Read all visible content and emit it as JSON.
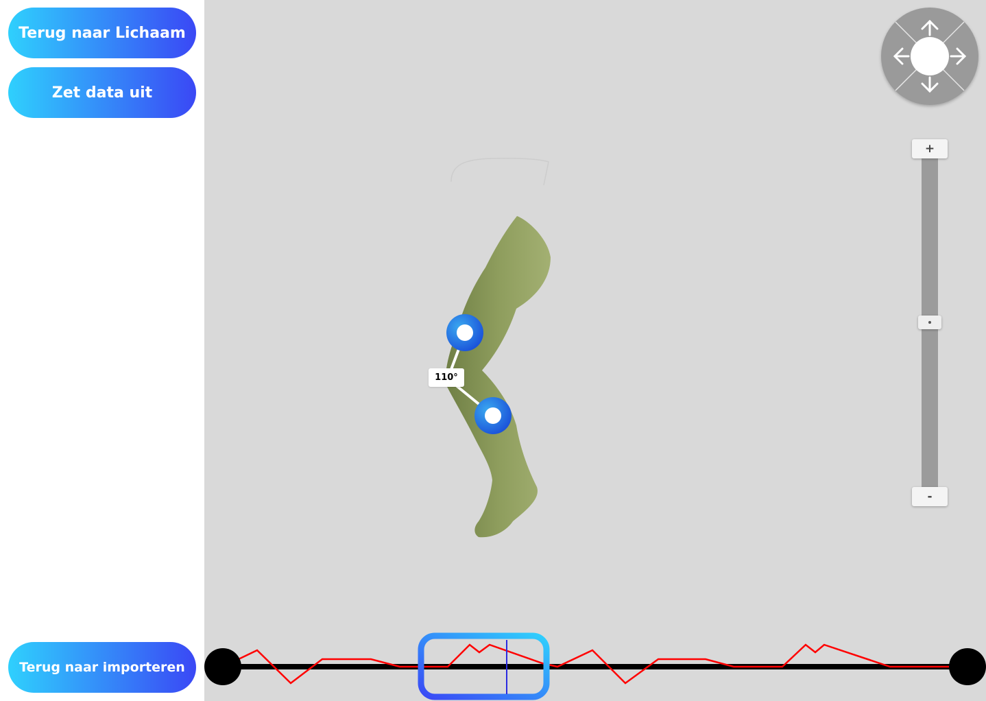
{
  "sidebar": {
    "back_to_body_label": "Terug naar Lichaam",
    "toggle_data_label": "Zet data uit",
    "back_to_import_label": "Terug naar importeren"
  },
  "viewer": {
    "angle_label": "110°",
    "joint_color": "#1e6fe0",
    "leg_color": "#8a9a5b"
  },
  "zoom": {
    "plus_label": "+",
    "minus_label": "-",
    "level": 0.5
  },
  "navigation": {
    "icon": "pan-arrows-icon"
  },
  "timeline": {
    "track_color": "#000000",
    "curve_color": "#ff0000",
    "window_gradient": [
      "#2fd0fd",
      "#3a48f5"
    ],
    "cursor_color": "#2a2ae0"
  }
}
